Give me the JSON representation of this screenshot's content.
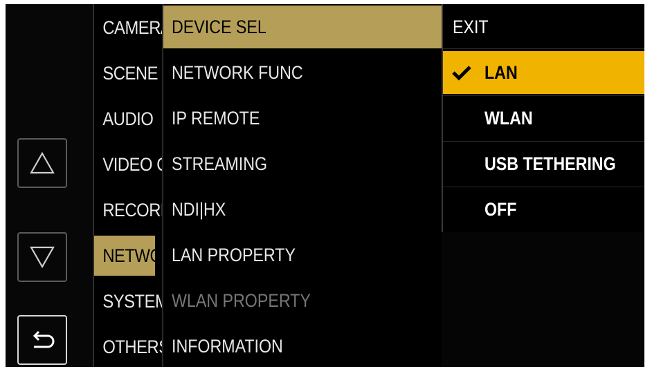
{
  "nav": {
    "up_icon": "up-triangle-icon",
    "down_icon": "down-triangle-icon",
    "back_icon": "return-arrow-icon"
  },
  "main_menu": {
    "items": [
      {
        "label": "CAMERA"
      },
      {
        "label": "SCENE FILE"
      },
      {
        "label": "AUDIO"
      },
      {
        "label": "VIDEO OUT"
      },
      {
        "label": "RECORDING"
      },
      {
        "label": "NETWORK",
        "selected": true
      },
      {
        "label": "SYSTEM"
      },
      {
        "label": "OTHERS"
      }
    ]
  },
  "sub_menu": {
    "items": [
      {
        "label": "DEVICE SEL",
        "selected": true
      },
      {
        "label": "NETWORK FUNC"
      },
      {
        "label": "IP REMOTE"
      },
      {
        "label": "STREAMING"
      },
      {
        "label": "NDI|HX"
      },
      {
        "label": "LAN PROPERTY"
      },
      {
        "label": "WLAN PROPERTY",
        "disabled": true
      },
      {
        "label": "INFORMATION"
      }
    ]
  },
  "options": {
    "exit_label": "EXIT",
    "items": [
      {
        "label": "LAN",
        "checked": true,
        "highlighted": true
      },
      {
        "label": "WLAN"
      },
      {
        "label": "USB TETHERING"
      },
      {
        "label": "OFF"
      }
    ],
    "check_icon": "checkmark-icon"
  },
  "colors": {
    "selected_row": "#b59f58",
    "highlight_option": "#f0b300",
    "background": "#000000"
  }
}
